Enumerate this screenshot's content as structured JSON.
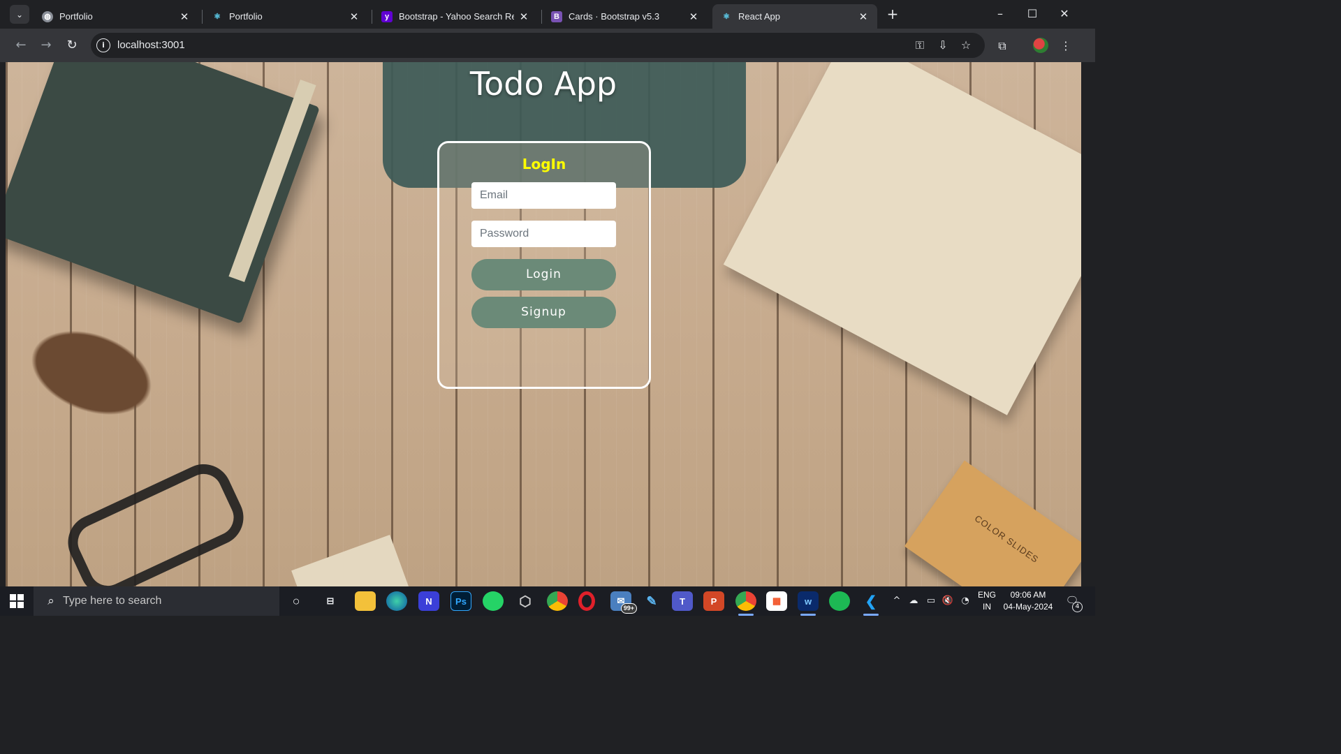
{
  "browser": {
    "tabs": [
      {
        "title": "Portfolio",
        "favicon": "globe-icon",
        "active": false
      },
      {
        "title": "Portfolio",
        "favicon": "react-icon",
        "active": false
      },
      {
        "title": "Bootstrap - Yahoo Search Results",
        "favicon": "yahoo-icon",
        "active": false
      },
      {
        "title": "Cards · Bootstrap v5.3",
        "favicon": "bootstrap-icon",
        "active": false
      },
      {
        "title": "React App",
        "favicon": "react-icon",
        "active": true
      }
    ],
    "url": "localhost:3001"
  },
  "app": {
    "title": "Todo App",
    "login": {
      "heading": "LogIn",
      "email_placeholder": "Email",
      "password_placeholder": "Password",
      "login_label": "Login",
      "signup_label": "Signup"
    },
    "colors": {
      "heading": "#ffff00",
      "button": "#6b8a78",
      "card_border": "#ffffff"
    },
    "decor_text": "COLOR SLIDES"
  },
  "taskbar": {
    "search_placeholder": "Type here to search",
    "apps": [
      {
        "name": "cortana",
        "label": "○"
      },
      {
        "name": "task-view",
        "label": ""
      },
      {
        "name": "file-explorer",
        "label": ""
      },
      {
        "name": "edge",
        "label": ""
      },
      {
        "name": "app-n",
        "label": ""
      },
      {
        "name": "photoshop",
        "label": "Ps"
      },
      {
        "name": "whatsapp",
        "label": ""
      },
      {
        "name": "app-hex",
        "label": ""
      },
      {
        "name": "chrome",
        "label": ""
      },
      {
        "name": "opera",
        "label": ""
      },
      {
        "name": "mail",
        "label": ""
      },
      {
        "name": "app-brush",
        "label": ""
      },
      {
        "name": "teams",
        "label": ""
      },
      {
        "name": "powerpoint",
        "label": "P"
      },
      {
        "name": "chrome-dev",
        "label": ""
      },
      {
        "name": "store",
        "label": ""
      },
      {
        "name": "webex",
        "label": ""
      },
      {
        "name": "spotify",
        "label": ""
      },
      {
        "name": "vscode",
        "label": ""
      }
    ],
    "mail_badge": "99+",
    "language": "ENG",
    "region": "IN",
    "time": "09:06 AM",
    "date": "04-May-2024",
    "notification_count": "4"
  }
}
